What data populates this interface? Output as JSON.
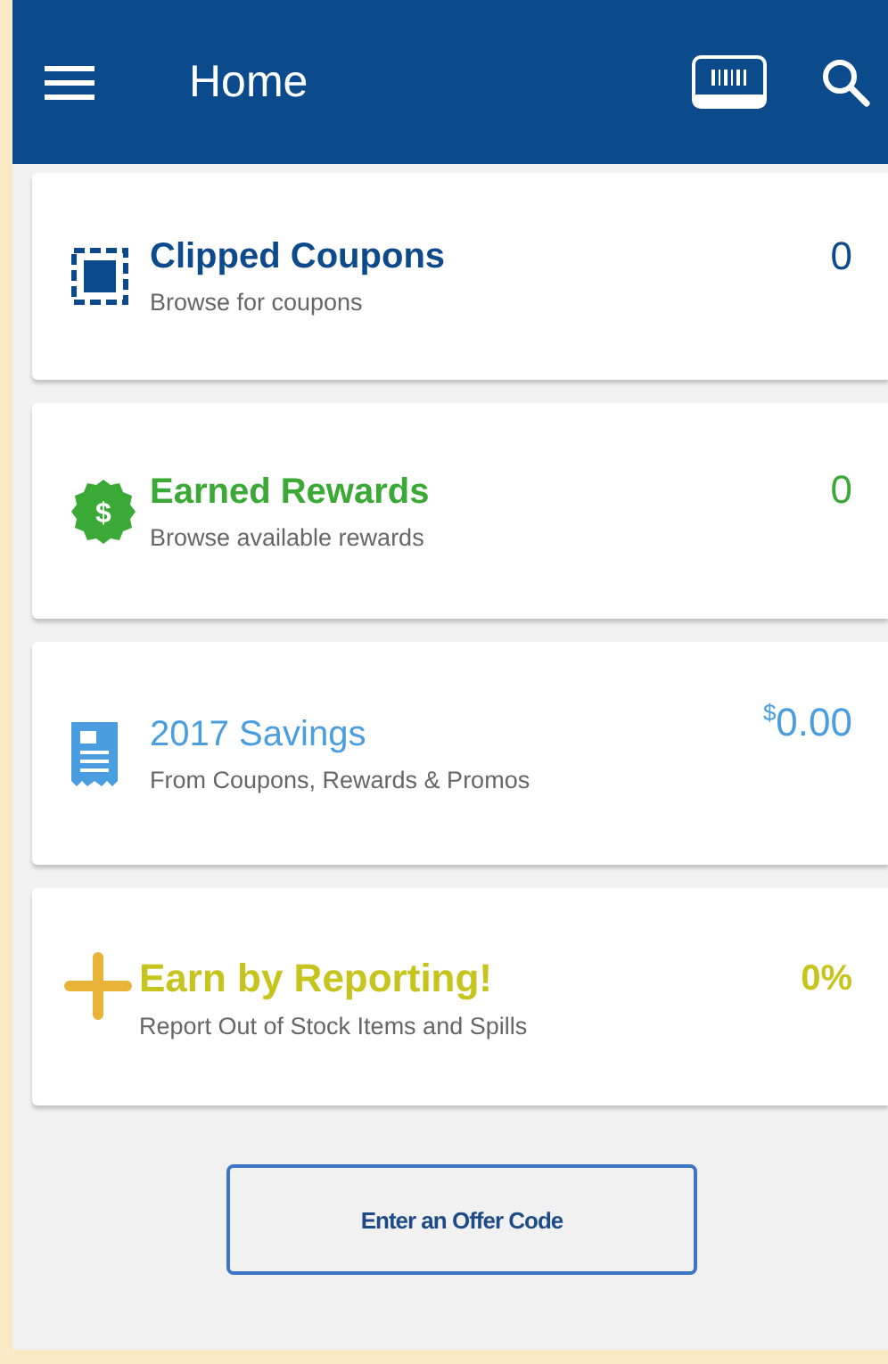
{
  "header": {
    "title": "Home"
  },
  "cards": [
    {
      "kind": "coupons",
      "title": "Clipped Coupons",
      "subtitle": "Browse for coupons",
      "value": "0",
      "color": "#0d4a8c"
    },
    {
      "kind": "rewards",
      "badge": "$",
      "title": "Earned Rewards",
      "subtitle": "Browse available rewards",
      "value": "0",
      "color": "#3aa935"
    },
    {
      "kind": "savings",
      "title": "2017 Savings",
      "subtitle": "From Coupons, Rewards & Promos",
      "currency": "$",
      "value": "0.00",
      "color": "#4a9ee0"
    },
    {
      "kind": "reporting",
      "title": "Earn by Reporting!",
      "subtitle": "Report Out of Stock Items and Spills",
      "value": "0%",
      "color": "#c8c41e"
    }
  ],
  "button": {
    "label": "Enter an Offer Code"
  }
}
